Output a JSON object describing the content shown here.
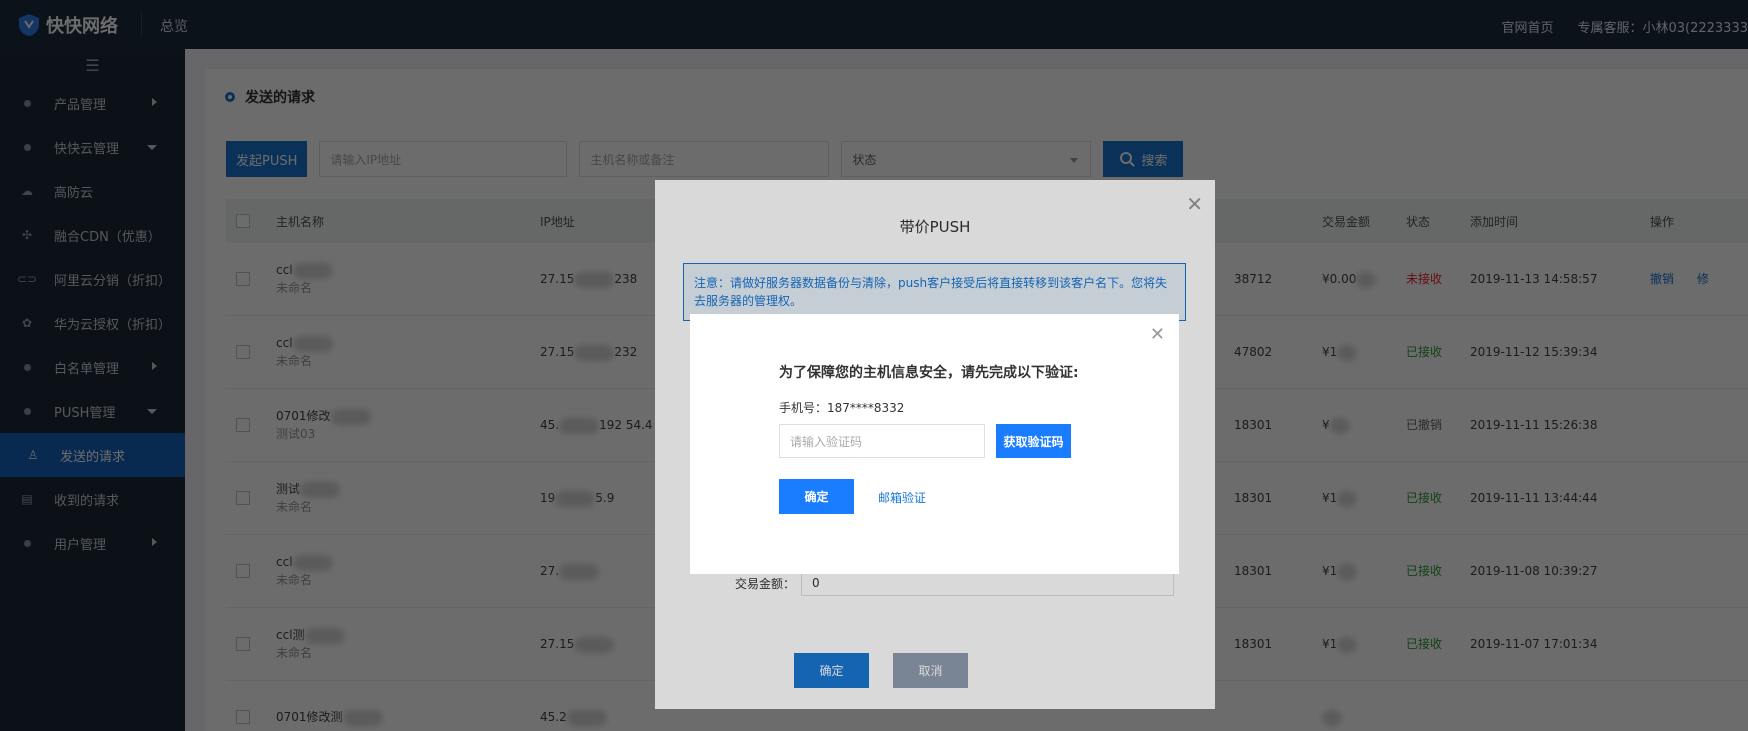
{
  "app": {
    "logo_text": "快快网络",
    "overview": "总览"
  },
  "topbar": {
    "home_link": "官网首页",
    "support": "专属客服：小林03(2223333"
  },
  "sidebar": {
    "items": [
      {
        "label": "产品管理",
        "icon": "dot",
        "arrow": "right"
      },
      {
        "label": "快快云管理",
        "icon": "dot",
        "arrow": "down"
      },
      {
        "label": "高防云",
        "icon": "cloud-icon",
        "arrow": ""
      },
      {
        "label": "融合CDN（优惠）",
        "icon": "network-icon",
        "arrow": ""
      },
      {
        "label": "阿里云分销（折扣）",
        "icon": "link-icon",
        "arrow": ""
      },
      {
        "label": "华为云授权（折扣）",
        "icon": "huawei-icon",
        "arrow": ""
      },
      {
        "label": "白名单管理",
        "icon": "dot",
        "arrow": "right"
      },
      {
        "label": "PUSH管理",
        "icon": "dot",
        "arrow": "down"
      },
      {
        "label": "发送的请求",
        "icon": "user-icon",
        "arrow": "",
        "active": true
      },
      {
        "label": "收到的请求",
        "icon": "doc-icon",
        "arrow": ""
      },
      {
        "label": "用户管理",
        "icon": "dot",
        "arrow": "right"
      }
    ]
  },
  "page": {
    "title": "发送的请求"
  },
  "toolbar": {
    "push_button": "发起PUSH",
    "ip_placeholder": "请输入IP地址",
    "host_placeholder": "主机名称或备注",
    "status_placeholder": "状态",
    "search_button": "搜索"
  },
  "table": {
    "headers": {
      "host": "主机名称",
      "ip": "IP地址",
      "amount": "交易金额",
      "status": "状态",
      "time": "添加时间",
      "action": "操作"
    },
    "rows": [
      {
        "host": "ccl",
        "note": "未命名",
        "ip": "27.15",
        "ip2": "238",
        "id": "38712",
        "amount": "¥0.00",
        "status": "未接收",
        "status_type": "red",
        "time": "2019-11-13 14:58:57",
        "action1": "撤销",
        "action2": "修"
      },
      {
        "host": "ccl",
        "note": "未命名",
        "ip": "27.15",
        "ip2": "232",
        "id": "47802",
        "amount": "¥1",
        "status": "已接收",
        "status_type": "green",
        "time": "2019-11-12 15:39:34",
        "action1": "",
        "action2": ""
      },
      {
        "host": "0701修改",
        "note": "测试03",
        "ip": "45.",
        "ip2": "192 54.4",
        "id": "18301",
        "amount": "¥",
        "status": "已撤销",
        "status_type": "gray",
        "time": "2019-11-11 15:26:38",
        "action1": "",
        "action2": ""
      },
      {
        "host": "测试",
        "note": "未命名",
        "ip": "19",
        "ip2": "5.9",
        "id": "18301",
        "amount": "¥1",
        "status": "已接收",
        "status_type": "green",
        "time": "2019-11-11 13:44:44",
        "action1": "",
        "action2": ""
      },
      {
        "host": "ccl",
        "note": "未命名",
        "ip": "27.",
        "ip2": "",
        "id": "18301",
        "amount": "¥1",
        "status": "已接收",
        "status_type": "green",
        "time": "2019-11-08 10:39:27",
        "action1": "",
        "action2": ""
      },
      {
        "host": "ccl测",
        "note": "未命名",
        "ip": "27.15",
        "ip2": "",
        "id": "18301",
        "amount": "¥1",
        "status": "已接收",
        "status_type": "green",
        "time": "2019-11-07 17:01:34",
        "action1": "",
        "action2": ""
      },
      {
        "host": "0701修改测",
        "note": "",
        "ip": "45.2",
        "ip2": "",
        "id": "",
        "amount": "",
        "status": "",
        "status_type": "gray",
        "time": "",
        "action1": "",
        "action2": ""
      }
    ]
  },
  "push_modal": {
    "title": "带价PUSH",
    "notice": "注意：请做好服务器数据备份与清除，push客户接受后将直接转移到该客户名下。您将失去服务器的管理权。",
    "amount_label": "交易金额：",
    "amount_value": "0",
    "ok": "确定",
    "cancel": "取消"
  },
  "verify_modal": {
    "title": "为了保障您的主机信息安全，请先完成以下验证:",
    "phone": "手机号：187****8332",
    "code_placeholder": "请输入验证码",
    "get_code": "获取验证码",
    "ok": "确定",
    "email_verify": "邮箱验证"
  },
  "colors": {
    "primary": "#1976d2",
    "sidebar_bg": "#1e2a3a",
    "topbar_bg": "#1f2d3d"
  }
}
